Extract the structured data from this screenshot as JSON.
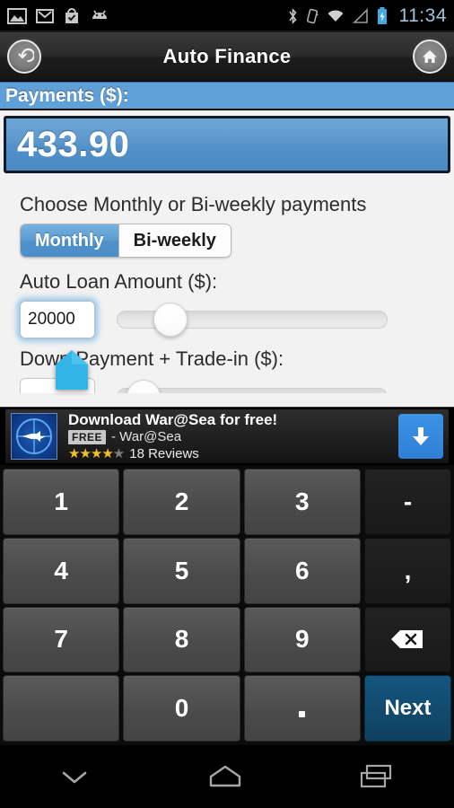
{
  "status_bar": {
    "icons_left": [
      "image-icon",
      "gmail-icon",
      "play-store-icon",
      "android-icon"
    ],
    "icons_right": [
      "bluetooth-icon",
      "vibrate-icon",
      "wifi-icon",
      "signal-icon",
      "battery-charging-icon"
    ],
    "time": "11:34"
  },
  "title_bar": {
    "title": "Auto Finance",
    "back_icon": "back-arrow-icon",
    "home_icon": "home-icon"
  },
  "payments": {
    "header": "Payments ($):",
    "value": "433.90"
  },
  "form": {
    "frequency_label": "Choose Monthly or Bi-weekly payments",
    "frequency_options": [
      {
        "label": "Monthly",
        "selected": true
      },
      {
        "label": "Bi-weekly",
        "selected": false
      }
    ],
    "loan_label": "Auto Loan Amount ($):",
    "loan_value": "20000",
    "loan_slider_percent": 20,
    "down_label": "Down Payment + Trade-in ($):",
    "down_value": "",
    "down_slider_percent": 10
  },
  "ad": {
    "title": "Download War@Sea for free!",
    "badge": "FREE",
    "publisher": "- War@Sea",
    "stars_filled": 4,
    "stars_total": 5,
    "reviews": "18 Reviews",
    "icon": "warship-periscope-icon",
    "download_icon": "download-arrow-icon"
  },
  "keyboard": {
    "rows": [
      [
        {
          "label": "1",
          "type": "num",
          "name": "key-1"
        },
        {
          "label": "2",
          "type": "num",
          "name": "key-2"
        },
        {
          "label": "3",
          "type": "num",
          "name": "key-3"
        },
        {
          "label": "-",
          "type": "fn",
          "name": "key-minus"
        }
      ],
      [
        {
          "label": "4",
          "type": "num",
          "name": "key-4"
        },
        {
          "label": "5",
          "type": "num",
          "name": "key-5"
        },
        {
          "label": "6",
          "type": "num",
          "name": "key-6"
        },
        {
          "label": ",",
          "type": "fn",
          "name": "key-comma"
        }
      ],
      [
        {
          "label": "7",
          "type": "num",
          "name": "key-7"
        },
        {
          "label": "8",
          "type": "num",
          "name": "key-8"
        },
        {
          "label": "9",
          "type": "num",
          "name": "key-9"
        },
        {
          "label": "",
          "type": "fn",
          "name": "key-backspace",
          "icon": "backspace-icon"
        }
      ],
      [
        {
          "label": "",
          "type": "num",
          "name": "key-space",
          "icon": "space-icon"
        },
        {
          "label": "0",
          "type": "num",
          "name": "key-0"
        },
        {
          "label": ".",
          "type": "num",
          "name": "key-period",
          "icon": "dot-icon"
        },
        {
          "label": "Next",
          "type": "next",
          "name": "key-next"
        }
      ]
    ]
  },
  "system_nav": {
    "back_icon": "hide-keyboard-chevron-icon",
    "home_icon": "home-pentagon-icon",
    "recents_icon": "recents-icon"
  },
  "colors": {
    "accent_blue": "#5fa0d8",
    "result_blue": "#5290c9",
    "next_key": "#14567f",
    "keyboard_bg": "#0b0b0b",
    "page_bg": "#f2f2f2"
  }
}
